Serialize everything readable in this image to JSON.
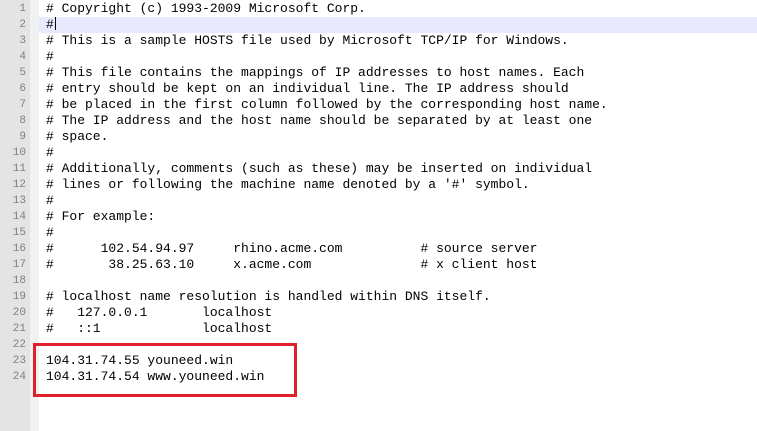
{
  "line_numbers": [
    "1",
    "2",
    "3",
    "4",
    "5",
    "6",
    "7",
    "8",
    "9",
    "10",
    "11",
    "12",
    "13",
    "14",
    "15",
    "16",
    "17",
    "18",
    "19",
    "20",
    "21",
    "22",
    "23",
    "24"
  ],
  "lines": [
    "# Copyright (c) 1993-2009 Microsoft Corp.",
    "#",
    "# This is a sample HOSTS file used by Microsoft TCP/IP for Windows.",
    "#",
    "# This file contains the mappings of IP addresses to host names. Each",
    "# entry should be kept on an individual line. The IP address should",
    "# be placed in the first column followed by the corresponding host name.",
    "# The IP address and the host name should be separated by at least one",
    "# space.",
    "#",
    "# Additionally, comments (such as these) may be inserted on individual",
    "# lines or following the machine name denoted by a '#' symbol.",
    "#",
    "# For example:",
    "#",
    "#      102.54.94.97     rhino.acme.com          # source server",
    "#       38.25.63.10     x.acme.com              # x client host",
    "",
    "# localhost name resolution is handled within DNS itself.",
    "#   127.0.0.1       localhost",
    "#   ::1             localhost",
    "",
    "104.31.74.55 youneed.win",
    "104.31.74.54 www.youneed.win"
  ],
  "current_line": 2,
  "colors": {
    "highlight_box": "#e0202c",
    "gutter_bg": "#e4e4e4",
    "current_line_bg": "#e8e8ff"
  }
}
